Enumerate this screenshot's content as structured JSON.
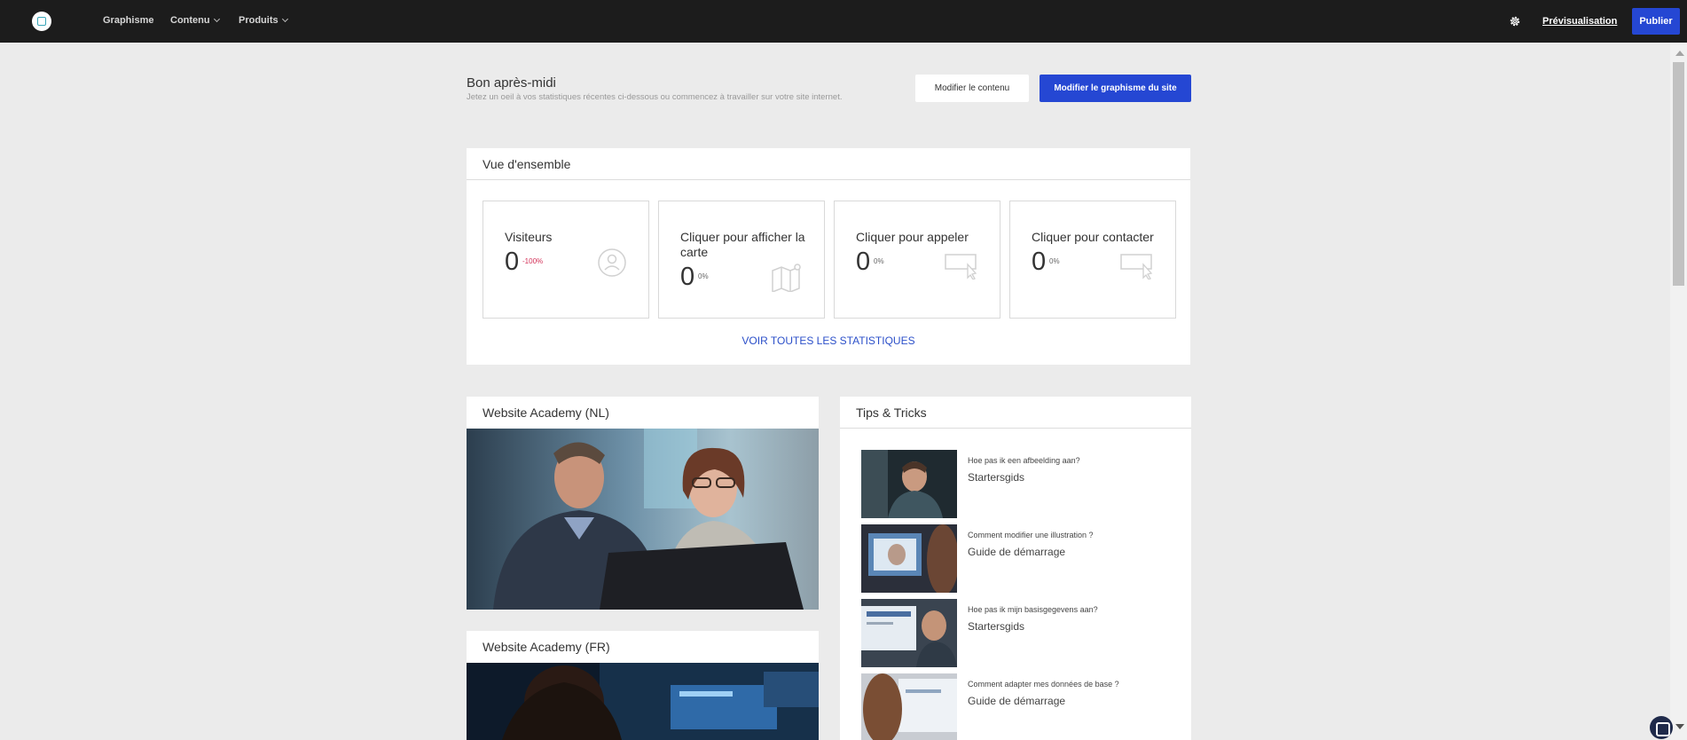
{
  "topbar": {
    "nav": [
      {
        "label": "Graphisme",
        "dropdown": false
      },
      {
        "label": "Contenu",
        "dropdown": true
      },
      {
        "label": "Produits",
        "dropdown": true
      }
    ],
    "preview_label": "Prévisualisation",
    "publish_label": "Publier",
    "settings_icon": "gear-icon"
  },
  "greeting": {
    "title": "Bon après-midi",
    "subtitle": "Jetez un oeil à vos statistiques récentes ci-dessous ou commencez à travailler sur votre site internet."
  },
  "actions": {
    "edit_content": "Modifier le contenu",
    "edit_design": "Modifier le graphisme du site"
  },
  "overview": {
    "title": "Vue d'ensemble",
    "stats": [
      {
        "label": "Visiteurs",
        "value": "0",
        "delta": "-100%",
        "negative": true,
        "icon": "person-icon"
      },
      {
        "label": "Cliquer pour afficher la carte",
        "value": "0",
        "delta": "0%",
        "negative": false,
        "icon": "map-icon"
      },
      {
        "label": "Cliquer pour appeler",
        "value": "0",
        "delta": "0%",
        "negative": false,
        "icon": "click-icon"
      },
      {
        "label": "Cliquer pour contacter",
        "value": "0",
        "delta": "0%",
        "negative": false,
        "icon": "click-icon"
      }
    ],
    "all_stats_link": "VOIR TOUTES LES STATISTIQUES"
  },
  "academy_nl": {
    "title": "Website Academy (NL)"
  },
  "academy_fr": {
    "title": "Website Academy (FR)"
  },
  "tips": {
    "title": "Tips & Tricks",
    "items": [
      {
        "question": "Hoe pas ik een afbeelding aan?",
        "category": "Startersgids"
      },
      {
        "question": "Comment modifier une illustration ?",
        "category": "Guide de démarrage"
      },
      {
        "question": "Hoe pas ik mijn basisgegevens aan?",
        "category": "Startersgids"
      },
      {
        "question": "Comment adapter mes données de base ?",
        "category": "Guide de démarrage"
      }
    ]
  },
  "colors": {
    "accent": "#2547d3",
    "negative": "#d33057",
    "topbar": "#1c1c1c",
    "background": "#ebebeb"
  }
}
